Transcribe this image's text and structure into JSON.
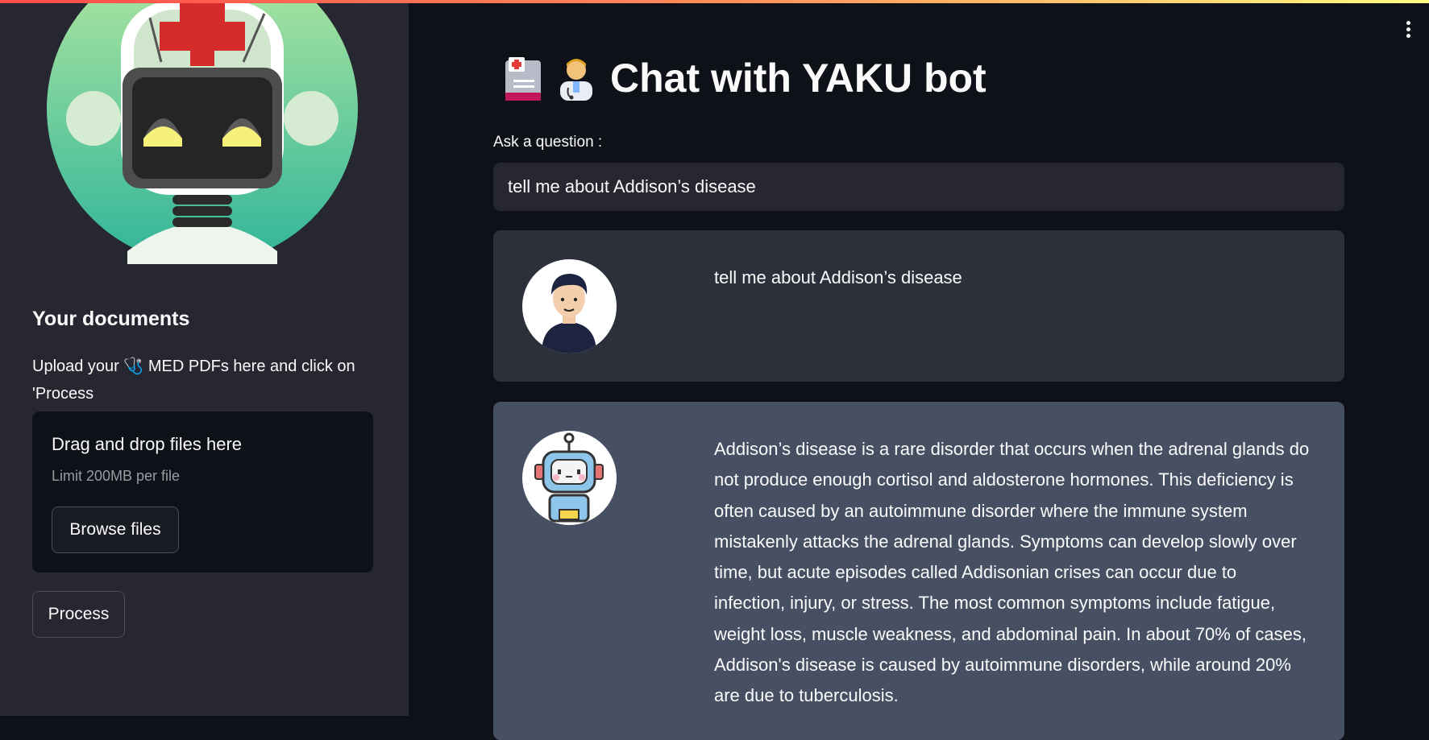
{
  "app": {
    "title": "Chat with YAKU bot",
    "title_icons": [
      "hospital-icon",
      "health-worker-icon"
    ]
  },
  "sidebar": {
    "heading": "Your documents",
    "description_prefix": "Upload your ",
    "description_icon": "stethoscope-icon",
    "description_suffix": " MED PDFs here and click on 'Process",
    "uploader": {
      "title": "Drag and drop files here",
      "limit": "Limit 200MB per file",
      "browse_label": "Browse files"
    },
    "process_label": "Process"
  },
  "main": {
    "ask_label": "Ask a question :",
    "ask_value": "tell me about Addison’s disease",
    "messages": [
      {
        "role": "user",
        "avatar": "user-avatar-icon",
        "text": "tell me about Addison’s disease"
      },
      {
        "role": "bot",
        "avatar": "robot-avatar-icon",
        "text": "Addison’s disease is a rare disorder that occurs when the adrenal glands do not produce enough cortisol and aldosterone hormones. This deficiency is often caused by an autoimmune disorder where the immune system mistakenly attacks the adrenal glands. Symptoms can develop slowly over time, but acute episodes called Addisonian crises can occur due to infection, injury, or stress. The most common symptoms include fatigue, weight loss, muscle weakness, and abdominal pain. In about 70% of cases, Addison's disease is caused by autoimmune disorders, while around 20% are due to tuberculosis."
      }
    ]
  },
  "colors": {
    "background": "#0e1117",
    "sidebar": "#262730",
    "user_message": "#2b303b",
    "bot_message": "#475063",
    "accent_gradient_start": "#ff4b4b",
    "accent_gradient_end": "#fffd80"
  }
}
